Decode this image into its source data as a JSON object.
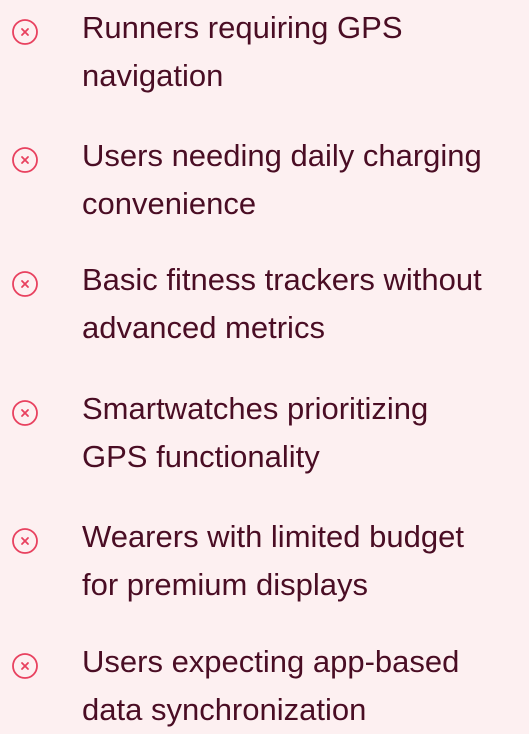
{
  "theme": {
    "background": "#fdf0f1",
    "text_color": "#4a0d24",
    "icon_color": "#e8415f"
  },
  "items": [
    {
      "icon": "x-circle-icon",
      "line1": "Runners requiring GPS",
      "line2": "navigation"
    },
    {
      "icon": "x-circle-icon",
      "line1": "Users needing daily charging",
      "line2": "convenience"
    },
    {
      "icon": "x-circle-icon",
      "line1": "Basic fitness trackers without",
      "line2": "advanced metrics"
    },
    {
      "icon": "x-circle-icon",
      "line1": "Smartwatches prioritizing",
      "line2": "GPS functionality"
    },
    {
      "icon": "x-circle-icon",
      "line1": "Wearers with limited budget",
      "line2": "for premium displays"
    },
    {
      "icon": "x-circle-icon",
      "line1": "Users expecting app-based",
      "line2": "data synchronization"
    }
  ]
}
